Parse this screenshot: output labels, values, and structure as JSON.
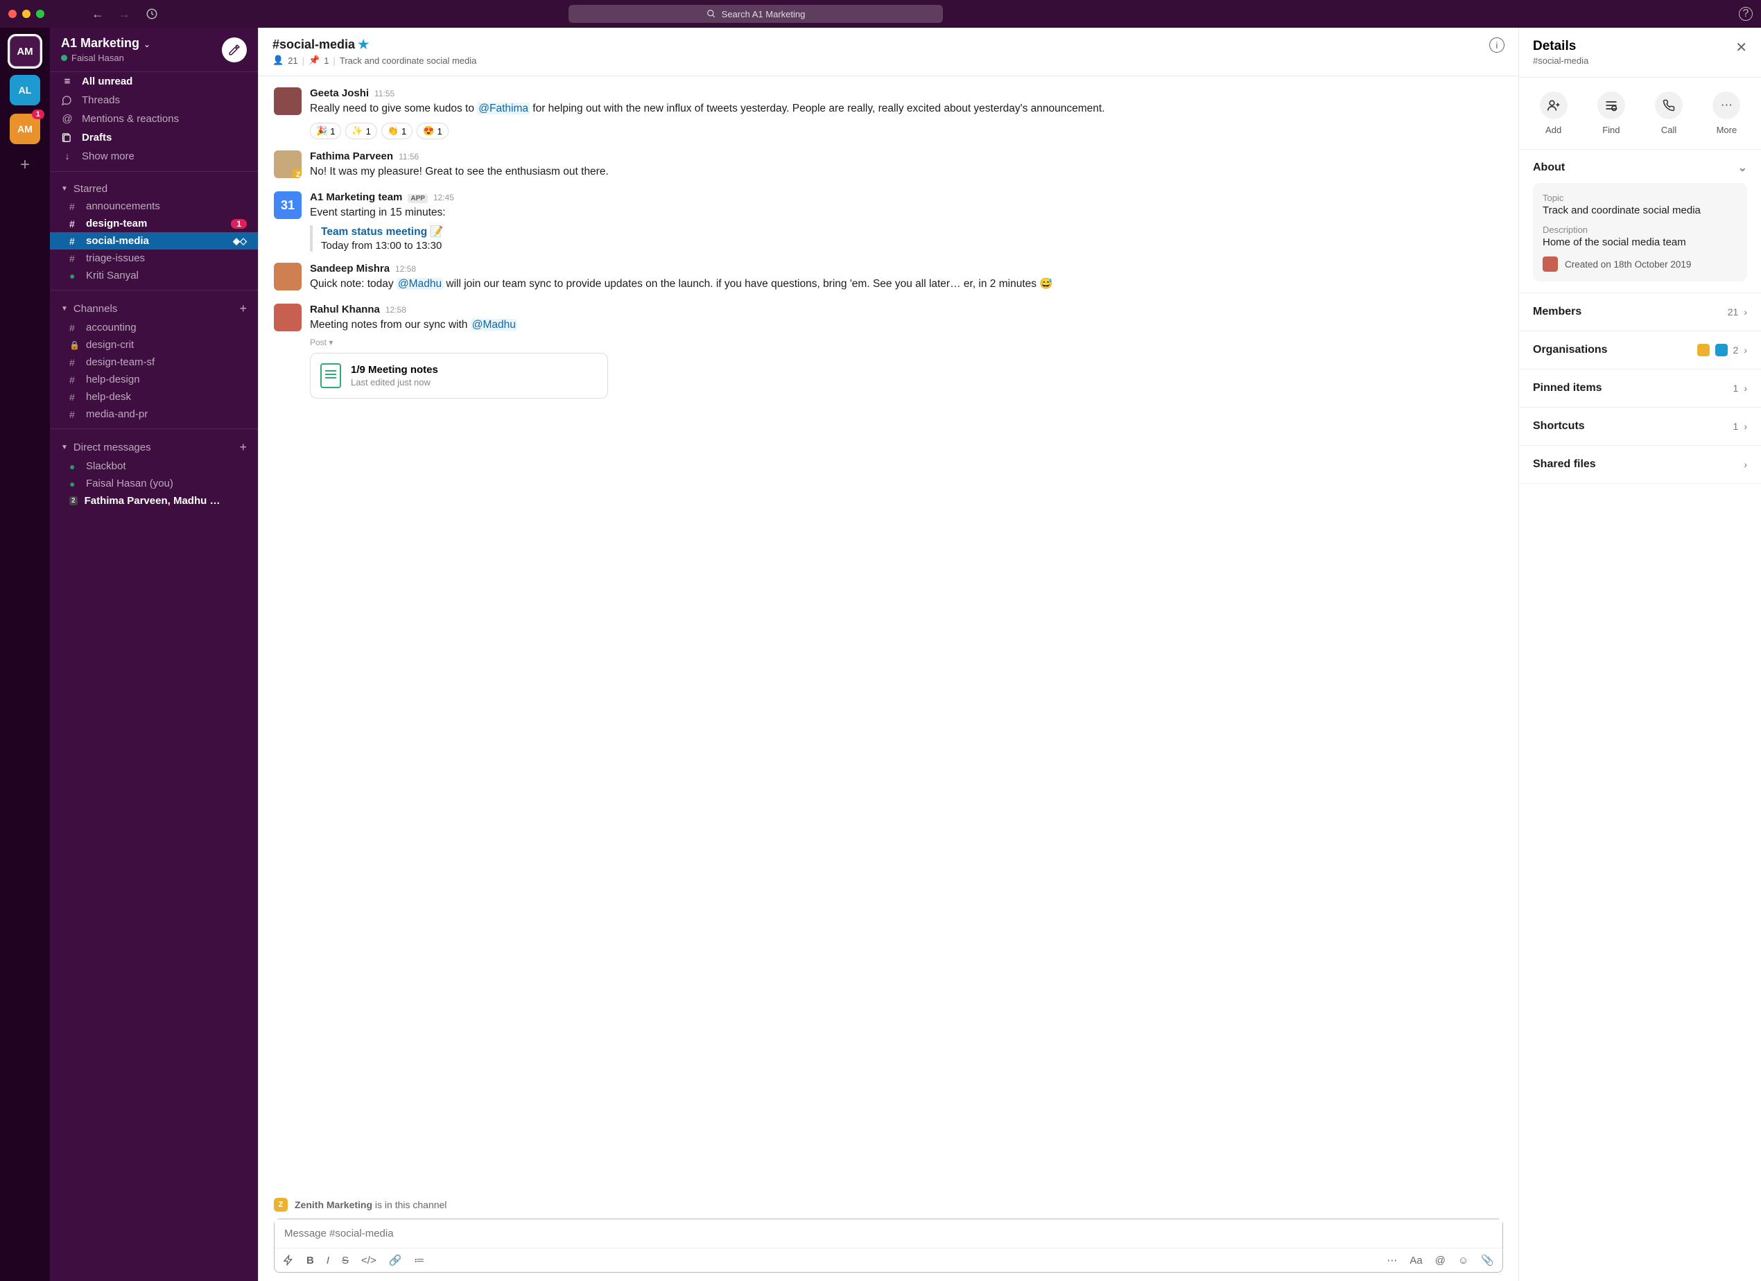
{
  "search": {
    "placeholder": "Search A1 Marketing"
  },
  "workspaces": {
    "am2_badge": "1"
  },
  "sidebar": {
    "workspace": "A1 Marketing",
    "user": "Faisal Hasan",
    "nav": {
      "unread": "All unread",
      "threads": "Threads",
      "mentions": "Mentions & reactions",
      "drafts": "Drafts",
      "more": "Show more"
    },
    "sections": {
      "starred": "Starred",
      "channels": "Channels",
      "dms": "Direct messages"
    },
    "starred": [
      {
        "pre": "#",
        "name": "announcements"
      },
      {
        "pre": "#",
        "name": "design-team",
        "badge": "1",
        "bold": true
      },
      {
        "pre": "#",
        "name": "social-media",
        "selected": true
      },
      {
        "pre": "#",
        "name": "triage-issues"
      },
      {
        "pre": "●",
        "name": "Kriti Sanyal"
      }
    ],
    "channels": [
      {
        "pre": "#",
        "name": "accounting"
      },
      {
        "pre": "🔒",
        "name": "design-crit"
      },
      {
        "pre": "#",
        "name": "design-team-sf"
      },
      {
        "pre": "#",
        "name": "help-design"
      },
      {
        "pre": "#",
        "name": "help-desk"
      },
      {
        "pre": "#",
        "name": "media-and-pr"
      }
    ],
    "dms": [
      {
        "pre": "●",
        "name": "Slackbot"
      },
      {
        "pre": "●",
        "name": "Faisal Hasan (you)"
      },
      {
        "pre": "2",
        "name": "Fathima Parveen, Madhu …",
        "bold": true
      }
    ]
  },
  "channel": {
    "name": "#social-media",
    "members": "21",
    "pins": "1",
    "topic": "Track and coordinate social media",
    "composer_placeholder": "Message #social-media"
  },
  "messages": {
    "m1": {
      "author": "Geeta Joshi",
      "time": "11:55",
      "text_a": "Really need to give some kudos to ",
      "mention": "@Fathima",
      "text_b": " for helping out with the new influx of tweets yesterday. People are really, really excited about yesterday's announcement.",
      "r1": "1",
      "r2": "1",
      "r3": "1",
      "r4": "1"
    },
    "m2": {
      "author": "Fathima Parveen",
      "time": "11:56",
      "text": "No! It was my pleasure! Great to see the enthusiasm out there."
    },
    "m3": {
      "author": "A1 Marketing team",
      "time": "12:45",
      "app": "APP",
      "text": "Event starting in 15 minutes:",
      "event_title": "Team status meeting 📝",
      "event_time": "Today from 13:00 to 13:30",
      "cal": "31"
    },
    "m4": {
      "author": "Sandeep Mishra",
      "time": "12:58",
      "text_a": "Quick note: today ",
      "mention": "@Madhu",
      "text_b": " will join our team sync to provide updates on the launch. if you have questions, bring 'em. See you all later… er, in 2 minutes 😅"
    },
    "m5": {
      "author": "Rahul Khanna",
      "time": "12:58",
      "text_a": "Meeting notes from our sync with ",
      "mention": "@Madhu",
      "post": "Post ▾",
      "file_title": "1/9 Meeting notes",
      "file_sub": "Last edited just now"
    }
  },
  "notice": {
    "org": "Zenith Marketing",
    "rest": " is in this channel"
  },
  "details": {
    "title": "Details",
    "sub": "#social-media",
    "actions": {
      "add": "Add",
      "find": "Find",
      "call": "Call",
      "more": "More"
    },
    "about": {
      "hd": "About",
      "topic_label": "Topic",
      "topic": "Track and coordinate social media",
      "desc_label": "Description",
      "desc": "Home of the social media team",
      "created": "Created on 18th October 2019"
    },
    "rows": {
      "members": "Members",
      "members_val": "21",
      "orgs": "Organisations",
      "orgs_val": "2",
      "pinned": "Pinned items",
      "pinned_val": "1",
      "shortcuts": "Shortcuts",
      "shortcuts_val": "1",
      "files": "Shared files"
    }
  }
}
